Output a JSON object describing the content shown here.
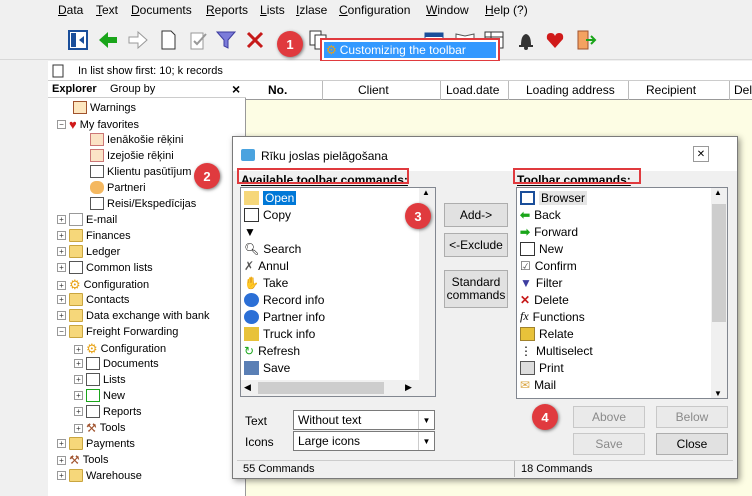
{
  "menu": [
    "Data",
    "Text",
    "Documents",
    "Reports",
    "Lists",
    "Izlase",
    "Configuration",
    "Window",
    "Help (?)"
  ],
  "tooltip": "Customizing the toolbar",
  "status_line": "In list show first: 10; k records",
  "explorer": {
    "tab1": "Explorer",
    "tab2": "Group by",
    "close": "×",
    "items": [
      "Warnings",
      "My favorites",
      "Ienākošie rēķini",
      "Izejošie rēķini",
      "Klientu pasūtījum",
      "Partneri",
      "Reisi/Ekspedīcijas",
      "E-mail",
      "Finances",
      "Ledger",
      "Common lists",
      "Configuration",
      "Contacts",
      "Data exchange with bank",
      "Freight Forwarding",
      "Configuration",
      "Documents",
      "Lists",
      "New",
      "Reports",
      "Tools",
      "Payments",
      "Tools",
      "Warehouse"
    ]
  },
  "grid": {
    "columns": [
      "No.",
      "Client",
      "Load.date",
      "Loading address",
      "Recipient",
      "Del"
    ]
  },
  "dialog": {
    "title": "Rīku joslas pielāgošana",
    "available_label": "Available toolbar commands:",
    "toolbar_label": "Toolbar commands:",
    "available": [
      "Open",
      "Copy",
      "",
      "Search",
      "Annul",
      "Take",
      "Record info",
      "Partner info",
      "Truck info",
      "Refresh",
      "Save"
    ],
    "toolbar": [
      "Browser",
      "Back",
      "Forward",
      "New",
      "Confirm",
      "Filter",
      "Delete",
      "Functions",
      "Relate",
      "Multiselect",
      "Print",
      "Mail"
    ],
    "add": "Add->",
    "exclude": "<-Exclude",
    "standard": "Standard commands",
    "above": "Above",
    "below": "Below",
    "save": "Save",
    "close": "Close",
    "text_label": "Text",
    "text_value": "Without text",
    "icons_label": "Icons",
    "icons_value": "Large icons",
    "left_count": "55 Commands",
    "right_count": "18 Commands"
  },
  "badges": [
    "1",
    "2",
    "3",
    "4"
  ],
  "colors": {
    "accent": "#e03a3e",
    "selection": "#0078d7",
    "grid_bg": "#fdfde4"
  }
}
